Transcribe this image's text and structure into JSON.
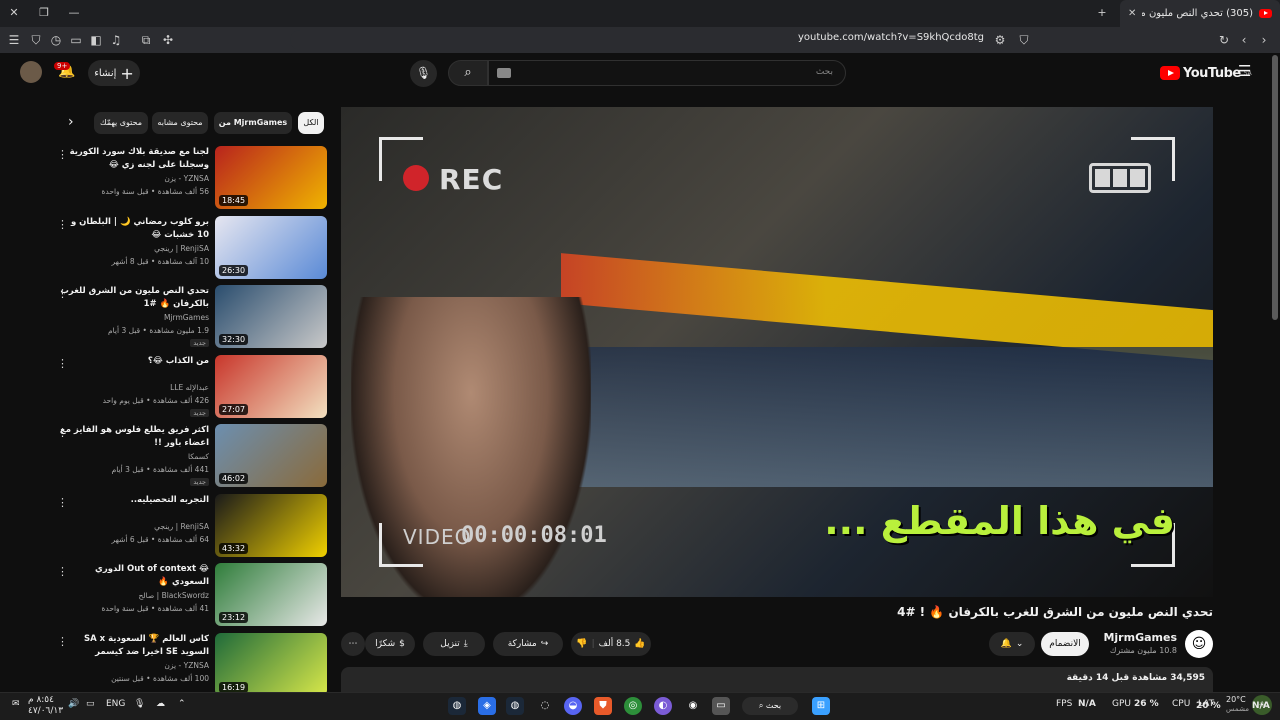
{
  "browser": {
    "tab_title": "(305) تحدي النص مليون من الش",
    "url": "youtube.com/watch?v=S9khQcdo8tg"
  },
  "masthead": {
    "search_placeholder": "بحث",
    "create_label": "إنشاء",
    "notification_badge": "9+",
    "logo_text": "YouTube",
    "logo_region": "SA"
  },
  "player": {
    "rec_label": "REC",
    "video_label": "VIDEO",
    "timecode": "00:00:08:01",
    "caption": "في هذا المقطع ..."
  },
  "video": {
    "title": "تحدي النص مليون من الشرق للغرب بالكرفان 🔥 ! #4",
    "channel_name": "MjrmGames",
    "subscribers": "10.8 مليون مشترك",
    "join_label": "الانضمام",
    "likes": "8.5 ألف",
    "share_label": "مشاركة",
    "download_label": "تنزيل",
    "thanks_label": "شكرًا",
    "views": "34,595 مشاهدة",
    "time_ago": "قبل 14 دقيقة"
  },
  "sidebar": {
    "chips": [
      "الكل",
      "من MjrmGames",
      "محتوى مشابه",
      "محتوى يهمّك"
    ],
    "items": [
      {
        "title": "لجنا مع صديقة بلاك سورد الكورية وسجلنا على لجنه زي 😂",
        "channel": "YZNSA - يزن",
        "meta": "56 ألف مشاهدة • قبل سنة واحدة",
        "duration": "18:45",
        "badge": ""
      },
      {
        "title": "برو كلوب رمضاني 🌙 | البلطان و 10 خشبات 😂",
        "channel": "RenjiSA | رينجي",
        "meta": "10 آلف مشاهدة • قبل 8 أشهر",
        "duration": "26:30",
        "badge": ""
      },
      {
        "title": "تحدي النص مليون من الشرق للغرب بالكرفان 🔥 #1",
        "channel": "MjrmGames",
        "meta": "1.9 مليون مشاهدة • قبل 3 أيام",
        "duration": "32:30",
        "badge": "جديد"
      },
      {
        "title": "من الكذاب 😂؟",
        "channel": "عبدالإله LLE",
        "meta": "426 ألف مشاهدة • قبل يوم واحد",
        "duration": "27:07",
        "badge": "جديد"
      },
      {
        "title": "اكثر فريق يطلع فلوس هو الفايز مع اعضاء باور !!",
        "channel": "كسمكا",
        "meta": "441 ألف مشاهدة • قبل 3 أيام",
        "duration": "46:02",
        "badge": "جديد"
      },
      {
        "title": "التجربه التحصيليه..",
        "channel": "RenjiSA | رينجي",
        "meta": "64 ألف مشاهدة • قبل 6 أشهر",
        "duration": "43:32",
        "badge": ""
      },
      {
        "title": "😂 Out of context الدوري السعودي 🔥",
        "channel": "BlackSwordz | صالح",
        "meta": "41 ألف مشاهدة • قبل سنة واحدة",
        "duration": "23:12",
        "badge": ""
      },
      {
        "title": "كاس العالم 🏆 السعودية SA x السويد SE اخيرا ضد كيسمر بيطولة!!",
        "channel": "YZNSA - يزن",
        "meta": "100 ألف مشاهدة • قبل سنتين",
        "duration": "16:19",
        "badge": ""
      }
    ]
  },
  "taskbar": {
    "search_label": "بحث",
    "language": "ENG",
    "fps_label": "FPS",
    "fps_value": "N/A",
    "gpu_label": "GPU",
    "gpu_value": "26 %",
    "cpu_label": "CPU",
    "cpu_value": "20 %",
    "lat_label": "LAT",
    "lat_value": "N/A",
    "temperature": "20°C",
    "weather": "مشمس",
    "time": "٨:٥٤ م",
    "date": "٤٧/٠٦/١٣"
  },
  "colors": {
    "background": "#0f0f0f",
    "caption_green": "#b9f03c",
    "rec_red": "#d0242a",
    "youtube_red": "#ff0000"
  }
}
